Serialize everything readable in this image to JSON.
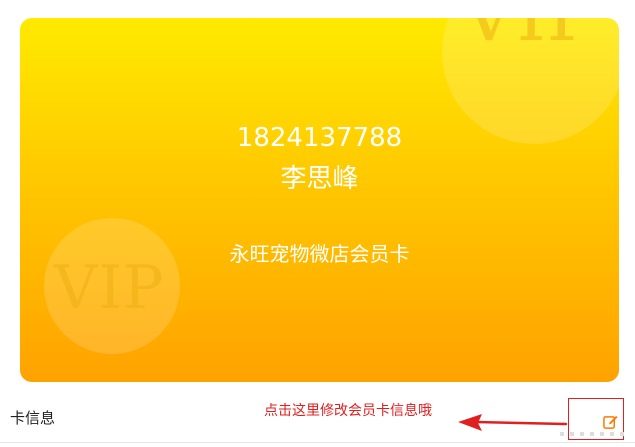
{
  "card": {
    "phone": "1824137788",
    "name": "李思峰",
    "shop_name": "永旺宠物微店会员卡",
    "watermark_top": "VIP",
    "watermark_bottom": "VIP",
    "gradient_colors": [
      "#ffea00",
      "#ffc400",
      "#ffa200"
    ]
  },
  "info_bar": {
    "label": "卡信息",
    "hint": "点击这里修改会员卡信息哦",
    "edit_icon": "edit-icon",
    "hint_color": "#e02020"
  }
}
